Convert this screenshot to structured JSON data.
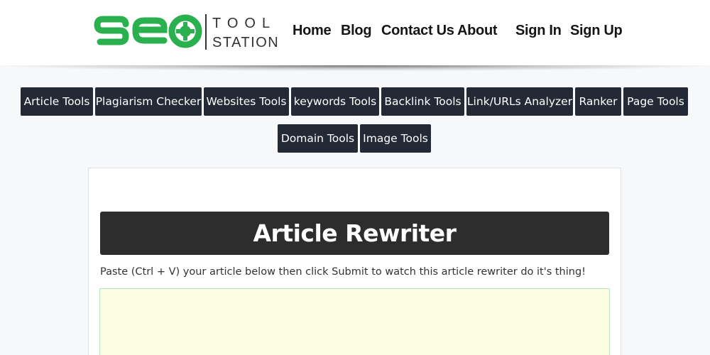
{
  "header": {
    "logo": {
      "mark": "seo",
      "word_top": "TOOL",
      "word_bottom": "STATION",
      "colors": {
        "green": "#2bb04f",
        "dark": "#333333"
      }
    },
    "nav": [
      {
        "label": "Home"
      },
      {
        "label": "Blog"
      },
      {
        "label": "Contact Us"
      },
      {
        "label": "About"
      },
      {
        "label": "Sign In"
      },
      {
        "label": "Sign Up"
      }
    ]
  },
  "tool_menu": {
    "row1": [
      {
        "label": "Article Tools"
      },
      {
        "label": "Plagiarism Checker"
      },
      {
        "label": "Websites Tools"
      },
      {
        "label": "keywords Tools"
      },
      {
        "label": "Backlink Tools"
      },
      {
        "label": "Link/URLs Analyzer"
      },
      {
        "label": "Ranker"
      },
      {
        "label": "Page Tools"
      }
    ],
    "row2": [
      {
        "label": "Domain Tools"
      },
      {
        "label": "Image Tools"
      }
    ]
  },
  "main": {
    "title": "Article Rewriter",
    "instructions": "Paste (Ctrl + V) your article below then click Submit to watch this article rewriter do it's thing!",
    "article_input": {
      "value": "",
      "placeholder": ""
    }
  },
  "colors": {
    "button_bg": "#232a36",
    "title_bar_bg": "#2d2d2d",
    "input_bg": "#fbfde3",
    "input_border": "#b9e2c6",
    "brand_green": "#2bb04f"
  }
}
